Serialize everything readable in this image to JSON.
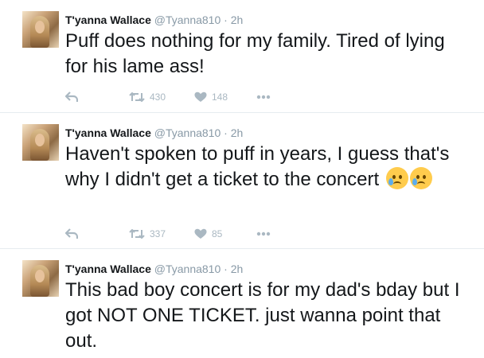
{
  "tweets": [
    {
      "name": "T'yanna Wallace",
      "handle": "@Tyanna810",
      "separator": "·",
      "time": "2h",
      "text": "Puff does nothing for my family. Tired of lying for his lame ass!",
      "retweets": "430",
      "likes": "148"
    },
    {
      "name": "T'yanna Wallace",
      "handle": "@Tyanna810",
      "separator": "·",
      "time": "2h",
      "text": "Haven't spoken to puff in years, I guess that's why I didn't get a ticket to the concert",
      "emojis": [
        "sad-but-relieved-face-icon",
        "sad-but-relieved-face-icon"
      ],
      "retweets": "337",
      "likes": "85"
    },
    {
      "name": "T'yanna Wallace",
      "handle": "@Tyanna810",
      "separator": "·",
      "time": "2h",
      "text": "This bad boy concert is for my dad's bday but I got NOT ONE TICKET. just wanna point that out."
    }
  ],
  "colors": {
    "text": "#14171a",
    "muted": "#8899a6",
    "icon": "#aab8c2",
    "divider": "#e6ecf0"
  }
}
